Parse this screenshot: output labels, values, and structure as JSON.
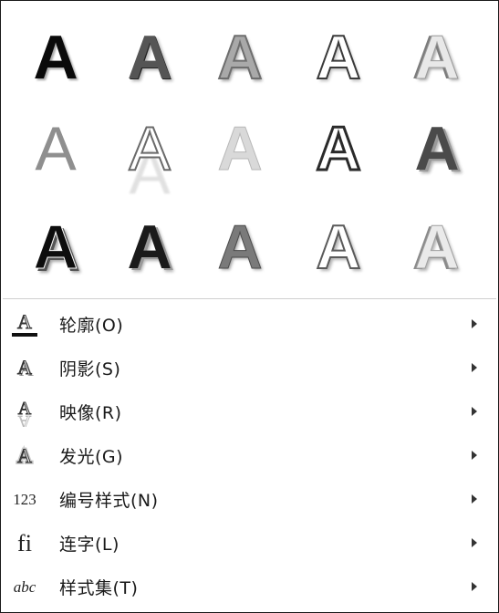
{
  "gallery": {
    "letter": "A",
    "effects": [
      "style-1",
      "style-2",
      "style-3",
      "style-4",
      "style-5",
      "style-6",
      "style-7",
      "style-8",
      "style-9",
      "style-10",
      "style-11",
      "style-12",
      "style-13",
      "style-14",
      "style-15"
    ]
  },
  "menu": {
    "items": [
      {
        "label": "轮廓(O)",
        "icon": "outline-icon",
        "icon_text": "A"
      },
      {
        "label": "阴影(S)",
        "icon": "shadow-icon",
        "icon_text": "A"
      },
      {
        "label": "映像(R)",
        "icon": "reflection-icon",
        "icon_text": "A"
      },
      {
        "label": "发光(G)",
        "icon": "glow-icon",
        "icon_text": "A"
      },
      {
        "label": "编号样式(N)",
        "icon": "number-style-icon",
        "icon_text": "123"
      },
      {
        "label": "连字(L)",
        "icon": "ligature-icon",
        "icon_text": "fi"
      },
      {
        "label": "样式集(T)",
        "icon": "stylistic-set-icon",
        "icon_text": "abc"
      }
    ]
  }
}
